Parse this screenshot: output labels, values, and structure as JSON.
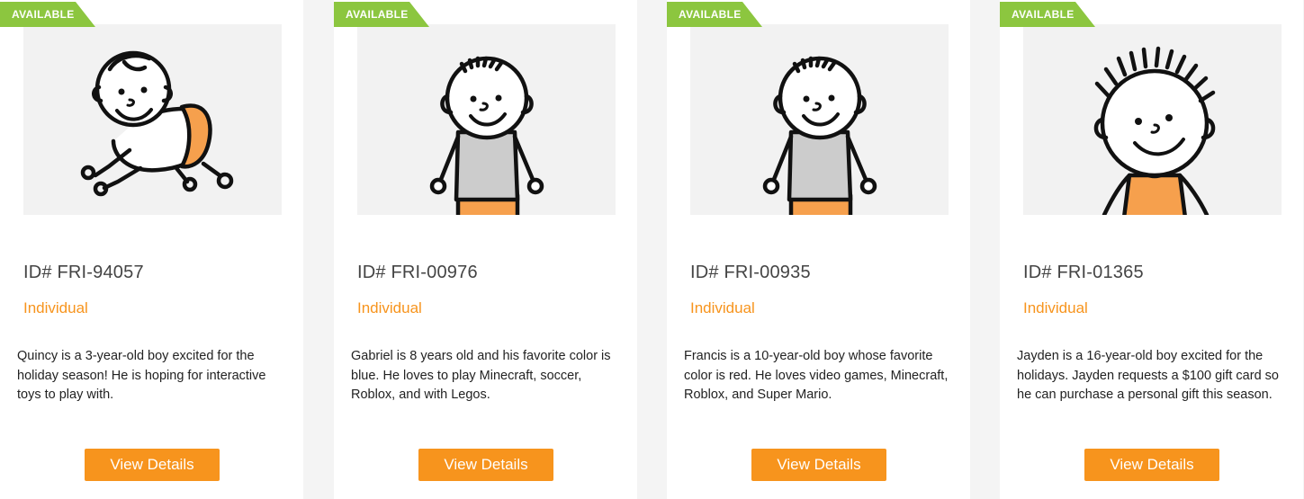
{
  "colors": {
    "ribbon": "#8cc63f",
    "accent": "#f7941d",
    "photo_bg": "#f2f2f2",
    "page_bg": "#f4f4f4"
  },
  "cards": [
    {
      "status": "AVAILABLE",
      "illustration": "crawling-baby-boy",
      "id_label": "ID# FRI-94057",
      "type": "Individual",
      "description": "Quincy is a 3-year-old boy excited for the holiday season! He is hoping for interactive toys to play with.",
      "button": "View Details"
    },
    {
      "status": "AVAILABLE",
      "illustration": "boy-gray-shirt",
      "id_label": "ID# FRI-00976",
      "type": "Individual",
      "description": "Gabriel is 8 years old and his favorite color is blue. He loves to play Minecraft, soccer, Roblox, and with Legos.",
      "button": "View Details"
    },
    {
      "status": "AVAILABLE",
      "illustration": "boy-gray-shirt",
      "id_label": "ID# FRI-00935",
      "type": "Individual",
      "description": "Francis is a 10-year-old boy whose favorite color is red. He loves video games, Minecraft, Roblox, and Super Mario.",
      "button": "View Details"
    },
    {
      "status": "AVAILABLE",
      "illustration": "teen-boy-spiky-hair",
      "id_label": "ID# FRI-01365",
      "type": "Individual",
      "description": "Jayden is a 16-year-old boy excited for the holidays. Jayden requests a $100 gift card so he can purchase a personal gift this season.",
      "button": "View Details"
    }
  ]
}
